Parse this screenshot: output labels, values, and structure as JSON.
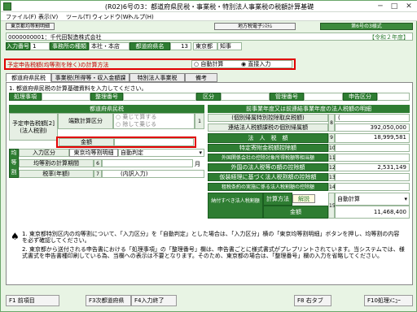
{
  "window": {
    "title": "(R02)6号の3：都道府県民税・事業税・特別法人事業税の税額計算基礎",
    "min": "─",
    "max": "□",
    "close": "✕"
  },
  "menu": [
    "ファイル(F)",
    "表示(V)",
    "ツール(T)",
    "ウィンドウ(W)",
    "ヘルプ(H)"
  ],
  "toolbar": {
    "left_tab": "東京都均等割明細",
    "mid_tab": "地方税電子ｼｽﾃﾑ",
    "right_tab": "第6号の3様式"
  },
  "company": {
    "code": "0000000001：千代田製造株式会社",
    "era": "【令和２年度】"
  },
  "input_row": {
    "input_no_label": "入力番号",
    "input_no": "1",
    "office_type_label": "事務所の種類",
    "office_type": "本社・本店",
    "pref_label": "都道府県名",
    "pref_code": "13",
    "pref_name": "東京都",
    "gov": "知事"
  },
  "calc_method": {
    "label": "予定申告税額(均等割を除く)の計算方法",
    "opt_auto": "自動計算",
    "opt_direct": "直接入力"
  },
  "tabs": [
    "都道府県民税",
    "事業税(所得等・収入金額課税)",
    "特別法人事業税",
    "備考"
  ],
  "instruction": "1. 都道府県民税の計算基礎資料を入力してください。",
  "header_row": {
    "proc": "処理事項",
    "org": "整理番号",
    "office": "事務所",
    "dist": "区分",
    "reg": "管理番号",
    "appl": "申告区分"
  },
  "left_section": {
    "title": "都道府県民税",
    "yotei_label": "予定申告税額[2](法人税割)",
    "type_label": "端数計算区分",
    "opt1": "乗じて算する",
    "opt2": "除して乗じる",
    "amount_label": "金額",
    "kin_label": "均",
    "nyuryoku_label": "入力区分",
    "nyuryoku_val": "東京均等割明細",
    "auto_label": "自動判定",
    "period_label": "均等割の計算期間",
    "period_no": "6",
    "months_label": "月",
    "tax_rate_label": "税率(年額)",
    "tax_rate_no": "7",
    "naiyou": "(内訳入力)",
    "row_tou": "等",
    "row_wari": "割"
  },
  "right_section": {
    "title": "前事業年度又は前連結事業年度の法人税額の明細",
    "r1_label": "(個別帰属特別控除取戻税額)",
    "r1_no": "8",
    "r1_val": "(",
    "r2_label": "連結法人税額課税の個別帰属額",
    "r2_val": "392,050,000",
    "r3_label": "法　人　税　額",
    "r3_no": "9",
    "r3_val": "18,999,581",
    "r4_label": "特定寄附金税額控除額",
    "r4_no": "10",
    "r4_val": "",
    "r5_label": "外国関係会社の控除対象所得税額等相当額",
    "r5_no": "11",
    "r5_val": "",
    "r6_label": "外国の法人税等の額の控除額",
    "r6_no": "12",
    "r6_val": "2,531,149",
    "r7_label": "仮装経理に基づく法人税割額の控除額",
    "r7_no": "13",
    "r7_val": "",
    "r8_label": "租税条約の実施に係る法人税割額の控除額",
    "r8_no": "14",
    "r8_val": "",
    "r9_label": "納付すべき法人税割額",
    "r9_method_label": "計算方法",
    "r9_kaisetsu": "解説",
    "r9_no": "15",
    "r9_method": "自動計算",
    "r9_amt_label": "金額",
    "r9_val": "11,468,400"
  },
  "notes": {
    "n1": "1. 東京都特別区内の均等割について、「入力区分」を「自動判定」とした場合は、「入力区分」横の「東京均等割明細」ボタンを押し、均等割の内容を必ず確認してください。",
    "n2": "2. 東京都から送付される申告書における「処理事項」の「整理番号」欄は、申告書ごとに様式書式がプレプリントされています。当システムでは、様式書式を申告書種印刷している為、当欄への表示は不要となります。そのため、東京都の場合は、「整理番号」欄の入力を省略してください。"
  },
  "fkeys": [
    "F1 前項目",
    "F3次都道府県",
    "F4入力終了",
    "F8 右タブ",
    "F10処理ﾒﾆｭｰ"
  ],
  "colors": {
    "accent": "#2e7d32",
    "highlight": "#e00000",
    "bg": "#e8f4e4"
  }
}
